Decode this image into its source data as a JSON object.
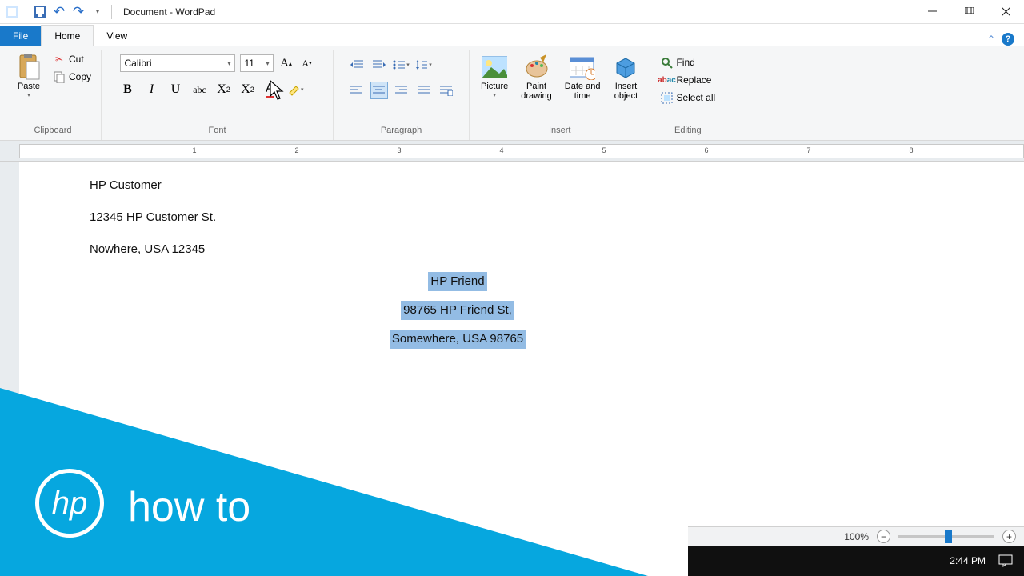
{
  "title": "Document - WordPad",
  "tabs": {
    "file": "File",
    "home": "Home",
    "view": "View"
  },
  "clipboard": {
    "label": "Clipboard",
    "paste": "Paste",
    "cut": "Cut",
    "copy": "Copy"
  },
  "font": {
    "label": "Font",
    "name": "Calibri",
    "size": "11"
  },
  "paragraph": {
    "label": "Paragraph"
  },
  "insert": {
    "label": "Insert",
    "picture": "Picture",
    "paint": "Paint\ndrawing",
    "date": "Date and\ntime",
    "object": "Insert\nobject"
  },
  "editing": {
    "label": "Editing",
    "find": "Find",
    "replace": "Replace",
    "select": "Select all"
  },
  "ruler": [
    "1",
    "2",
    "3",
    "4",
    "5",
    "6",
    "7",
    "8"
  ],
  "doc": {
    "sender": [
      "HP Customer",
      "12345 HP Customer St.",
      "Nowhere, USA 12345"
    ],
    "recipient": [
      "HP Friend",
      "98765 HP Friend St,",
      "Somewhere,  USA 98765"
    ]
  },
  "overlay": {
    "logo": "hp",
    "text": "how to"
  },
  "status": {
    "zoom": "100%"
  },
  "taskbar": {
    "time": "2:44 PM"
  }
}
